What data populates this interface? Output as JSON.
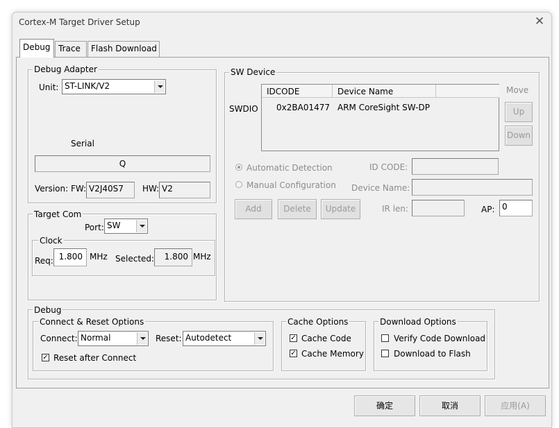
{
  "window": {
    "title": "Cortex-M Target Driver Setup"
  },
  "tabs": [
    {
      "label": "Debug",
      "active": true
    },
    {
      "label": "Trace",
      "active": false
    },
    {
      "label": "Flash Download",
      "active": false
    }
  ],
  "debug_adapter": {
    "legend": "Debug Adapter",
    "unit_label": "Unit:",
    "unit_value": "ST-LINK/V2",
    "serial_label": "Serial",
    "serial_value": "Q",
    "version_label": "Version: FW:",
    "fw_value": "V2J40S7",
    "hw_label": "HW:",
    "hw_value": "V2"
  },
  "target_com": {
    "legend": "Target Com",
    "port_label": "Port:",
    "port_value": "SW",
    "clock": {
      "legend": "Clock",
      "req_label": "Req:",
      "req_value": "1.800",
      "req_unit": "MHz",
      "selected_label": "Selected:",
      "selected_value": "1.800",
      "selected_unit": "MHz"
    }
  },
  "sw_device": {
    "legend": "SW Device",
    "row_label": "SWDIO",
    "columns": [
      "IDCODE",
      "Device Name"
    ],
    "rows": [
      {
        "idcode": "0x2BA01477",
        "name": "ARM CoreSight SW-DP"
      }
    ],
    "move_label": "Move",
    "up_label": "Up",
    "down_label": "Down",
    "auto_detection_label": "Automatic Detection",
    "manual_config_label": "Manual Configuration",
    "id_code_label": "ID CODE:",
    "device_name_label": "Device Name:",
    "ir_len_label": "IR len:",
    "ap_label": "AP:",
    "ap_value": "0",
    "add_label": "Add",
    "delete_label": "Delete",
    "update_label": "Update"
  },
  "debug": {
    "legend": "Debug",
    "connect_reset": {
      "legend": "Connect & Reset Options",
      "connect_label": "Connect:",
      "connect_value": "Normal",
      "reset_label": "Reset:",
      "reset_value": "Autodetect",
      "reset_after_connect_label": "Reset after Connect",
      "reset_after_connect_checked": true
    },
    "cache": {
      "legend": "Cache Options",
      "cache_code_label": "Cache Code",
      "cache_code_checked": true,
      "cache_memory_label": "Cache Memory",
      "cache_memory_checked": true
    },
    "download": {
      "legend": "Download Options",
      "verify_label": "Verify Code Download",
      "verify_checked": false,
      "download_flash_label": "Download to Flash",
      "download_flash_checked": false
    }
  },
  "footer": {
    "ok_label": "确定",
    "cancel_label": "取消",
    "apply_label": "应用(A)"
  },
  "check_glyph": "✓"
}
